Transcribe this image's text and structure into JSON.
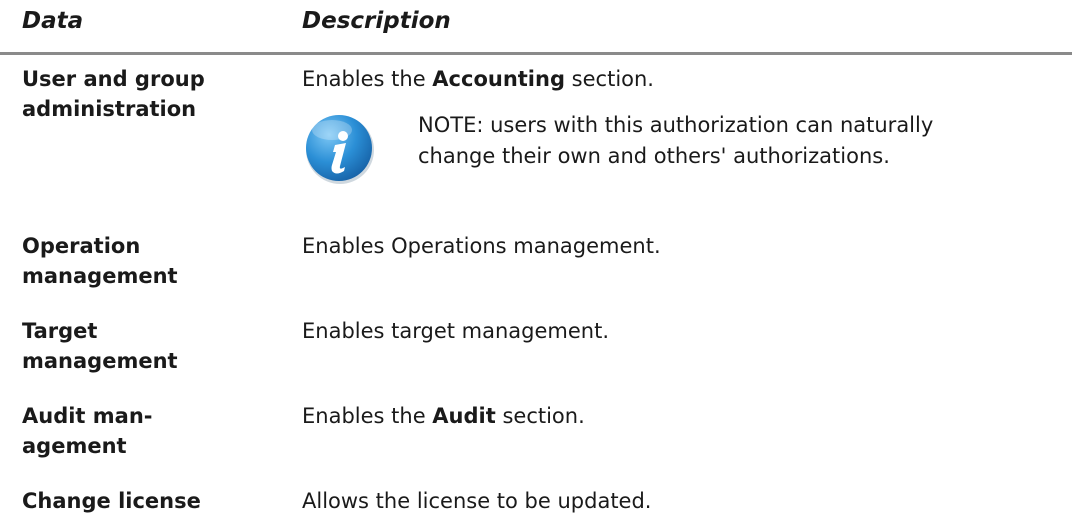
{
  "table": {
    "headers": {
      "data": "Data",
      "description": "Description"
    },
    "rows": [
      {
        "term_line1": "User and group",
        "term_line2": "administration",
        "desc_before": "Enables the ",
        "desc_bold": "Accounting",
        "desc_after": " section.",
        "note": {
          "icon": "info-icon",
          "line1": "NOTE: users with this authorization can naturally",
          "line2": "change their own and others' authorizations."
        }
      },
      {
        "term_line1": "Operation",
        "term_line2": "management",
        "desc": "Enables Operations management."
      },
      {
        "term_line1": "Target",
        "term_line2": "management",
        "desc": "Enables target management."
      },
      {
        "term_line1": "Audit man-",
        "term_line2": "agement",
        "desc_before": "Enables the ",
        "desc_bold": "Audit",
        "desc_after": " section."
      },
      {
        "term_line1": "Change license",
        "desc": "Allows the license to be updated."
      }
    ]
  },
  "colors": {
    "header_rule": "#8a8a8a",
    "text": "#1a1a1a",
    "icon_blue": "#2b8fd6"
  }
}
